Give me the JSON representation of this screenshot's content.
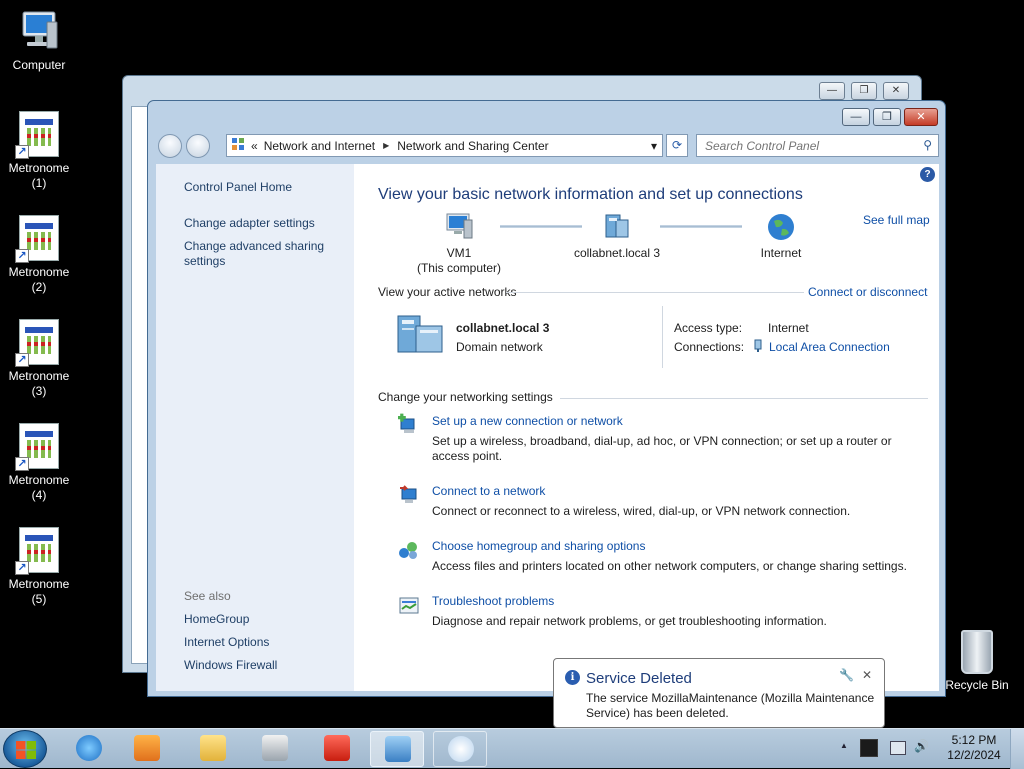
{
  "desktop": {
    "computer_label": "Computer",
    "metronome_icons": [
      {
        "line1": "Metronome",
        "line2": "(1)"
      },
      {
        "line1": "Metronome",
        "line2": "(2)"
      },
      {
        "line1": "Metronome",
        "line2": "(3)"
      },
      {
        "line1": "Metronome",
        "line2": "(4)"
      },
      {
        "line1": "Metronome",
        "line2": "(5)"
      }
    ],
    "recycle_bin_label": "Recycle Bin"
  },
  "window": {
    "min_glyph": "—",
    "max_glyph": "❐",
    "close_glyph": "✕",
    "breadcrumb": {
      "overflow": "«",
      "items": [
        "Network and Internet",
        "Network and Sharing Center"
      ],
      "sep": "▶",
      "dropdown": "▾"
    },
    "refresh_glyph": "⟳",
    "search_placeholder": "Search Control Panel",
    "search_glyph": "⚲",
    "help_glyph": "?"
  },
  "sidebar": {
    "home": "Control Panel Home",
    "links": [
      "Change adapter settings",
      "Change advanced sharing settings"
    ],
    "see_also_header": "See also",
    "see_also": [
      "HomeGroup",
      "Internet Options",
      "Windows Firewall"
    ]
  },
  "main": {
    "title": "View your basic network information and set up connections",
    "see_full_map": "See full map",
    "map_nodes": [
      {
        "line1": "VM1",
        "line2": "(This computer)"
      },
      {
        "line1": "collabnet.local  3",
        "line2": ""
      },
      {
        "line1": "Internet",
        "line2": ""
      }
    ],
    "active_networks_header": "View your active networks",
    "connect_or_disconnect": "Connect or disconnect",
    "network": {
      "name": "collabnet.local  3",
      "type": "Domain network",
      "access_type_label": "Access type:",
      "access_type_value": "Internet",
      "connections_label": "Connections:",
      "connections_value": "Local Area Connection"
    },
    "settings_header": "Change your networking settings",
    "tasks": [
      {
        "title": "Set up a new connection or network",
        "desc": "Set up a wireless, broadband, dial-up, ad hoc, or VPN connection; or set up a router or access point."
      },
      {
        "title": "Connect to a network",
        "desc": "Connect or reconnect to a wireless, wired, dial-up, or VPN network connection."
      },
      {
        "title": "Choose homegroup and sharing options",
        "desc": "Access files and printers located on other network computers, or change sharing settings."
      },
      {
        "title": "Troubleshoot problems",
        "desc": "Diagnose and repair network problems, or get troubleshooting information."
      }
    ]
  },
  "notification": {
    "title": "Service Deleted",
    "body": "The service MozillaMaintenance (Mozilla Maintenance Service) has been deleted.",
    "close_glyph": "✕",
    "settings_glyph": "🔧",
    "info_glyph": "i"
  },
  "taskbar": {
    "time": "5:12 PM",
    "date": "12/2/2024",
    "tray_up_glyph": "▲",
    "speaker_glyph": "🔊"
  },
  "colors": {
    "link": "#0f4fa6",
    "title": "#1e3d7a",
    "sidebar_bg": "#e9eff8"
  }
}
